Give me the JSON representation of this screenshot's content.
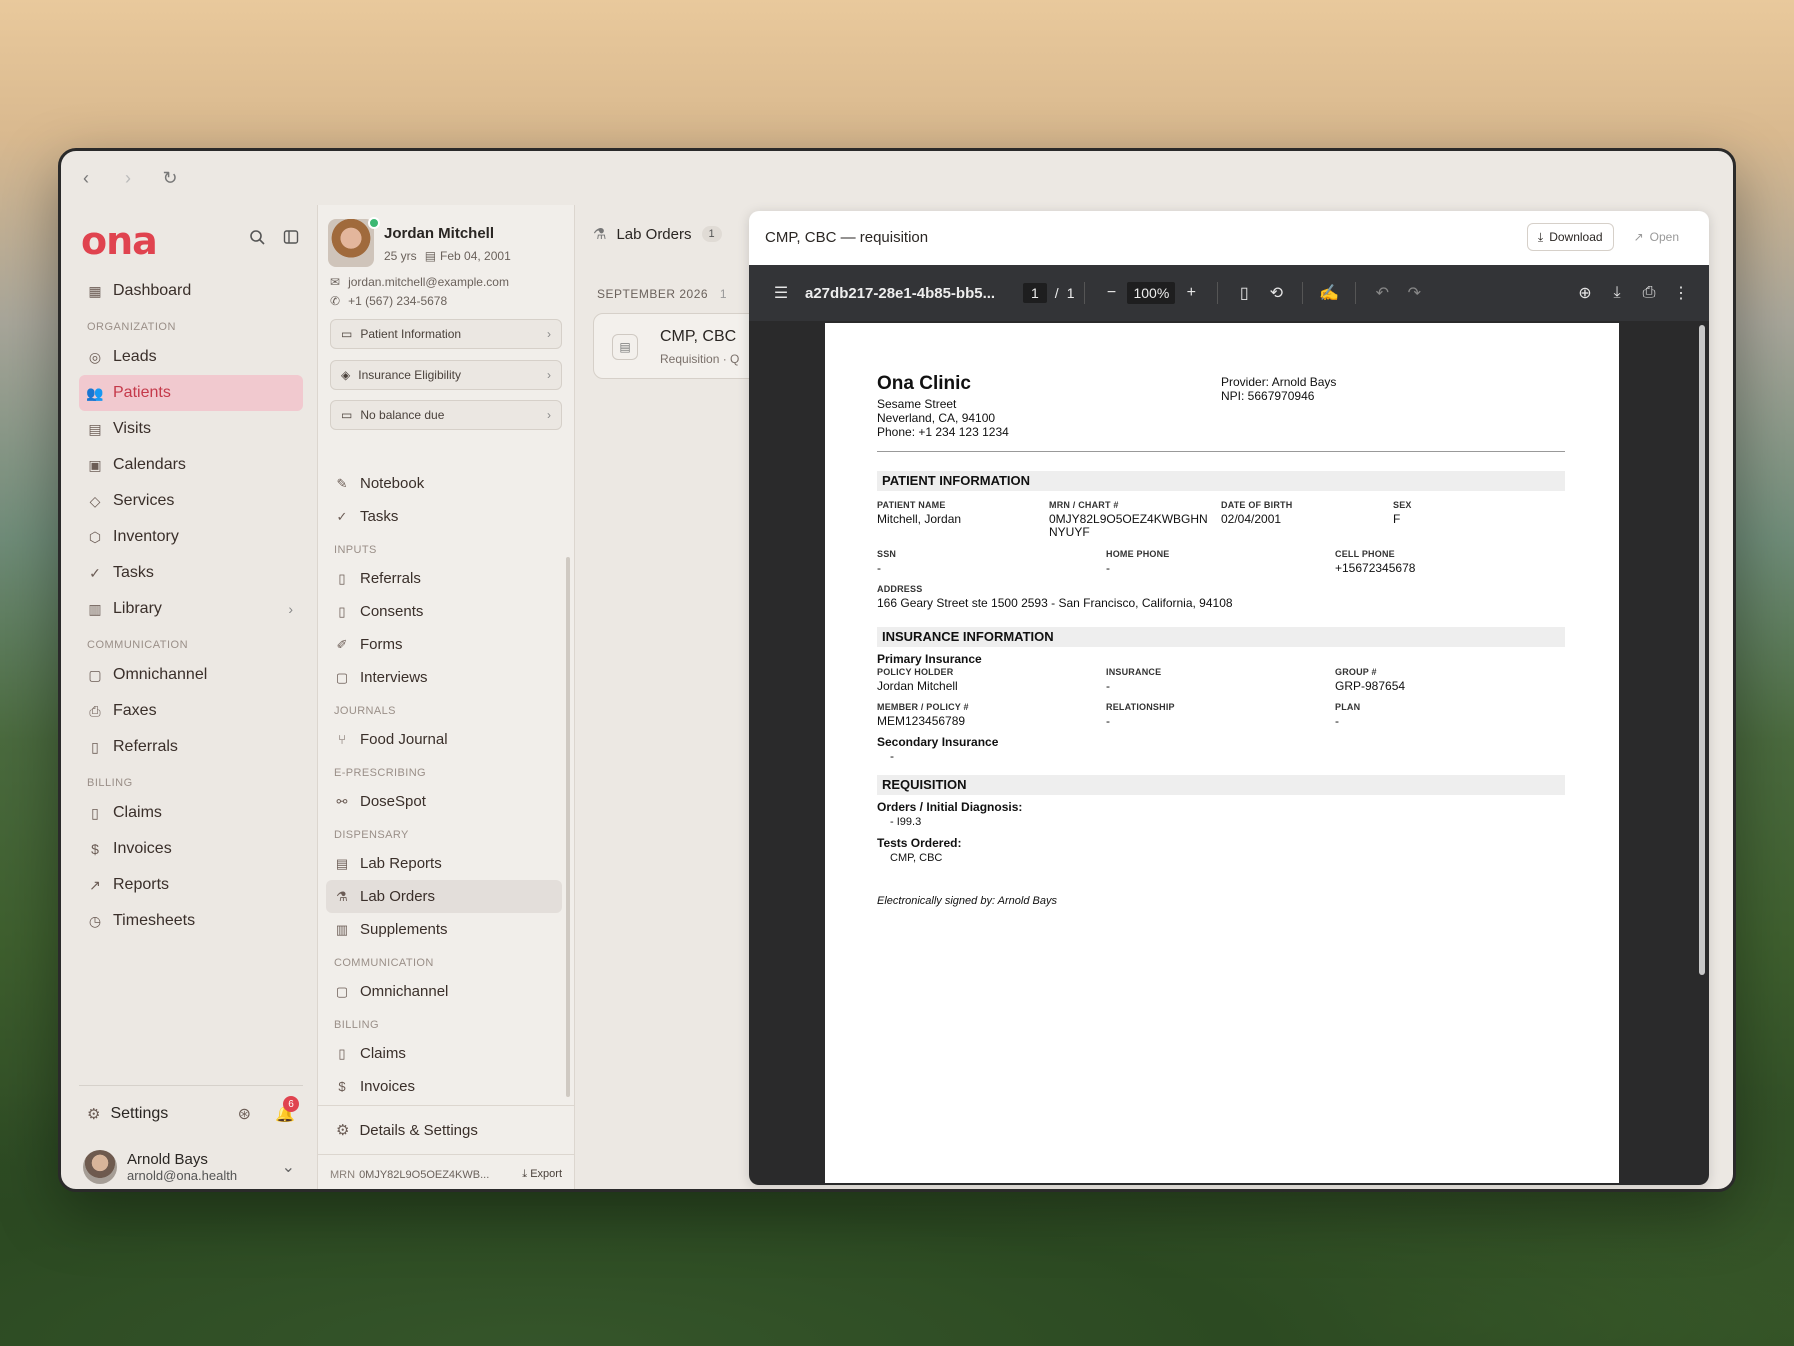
{
  "browser": {
    "back": "‹",
    "forward": "›",
    "reload": "↻"
  },
  "nav": {
    "logo": "ona",
    "items": [
      {
        "label": "Dashboard"
      },
      {
        "section": "ORGANIZATION"
      },
      {
        "label": "Leads"
      },
      {
        "label": "Patients"
      },
      {
        "label": "Visits"
      },
      {
        "label": "Calendars"
      },
      {
        "label": "Services"
      },
      {
        "label": "Inventory"
      },
      {
        "label": "Tasks"
      },
      {
        "label": "Library"
      },
      {
        "section": "COMMUNICATION"
      },
      {
        "label": "Omnichannel"
      },
      {
        "label": "Faxes"
      },
      {
        "label": "Referrals"
      },
      {
        "section": "BILLING"
      },
      {
        "label": "Claims"
      },
      {
        "label": "Invoices"
      },
      {
        "label": "Reports"
      },
      {
        "label": "Timesheets"
      }
    ],
    "settings": "Settings",
    "notifications_count": "6",
    "user": {
      "name": "Arnold Bays",
      "email": "arnold@ona.health"
    }
  },
  "patient": {
    "name": "Jordan Mitchell",
    "age": "25 yrs",
    "dob": "Feb 04, 2001",
    "email": "jordan.mitchell@example.com",
    "phone": "+1 (567) 234-5678",
    "buttons": [
      "Patient Information",
      "Insurance Eligibility",
      "No balance due"
    ],
    "menu": {
      "top": [
        "Notebook",
        "Tasks"
      ],
      "inputs_section": "INPUTS",
      "inputs": [
        "Referrals",
        "Consents",
        "Forms",
        "Interviews"
      ],
      "journals_section": "JOURNALS",
      "journals": [
        "Food Journal"
      ],
      "erx_section": "E-PRESCRIBING",
      "erx": [
        "DoseSpot"
      ],
      "dispensary_section": "DISPENSARY",
      "dispensary": [
        "Lab Reports",
        "Lab Orders",
        "Supplements"
      ],
      "comm_section": "COMMUNICATION",
      "comm": [
        "Omnichannel"
      ],
      "billing_section": "BILLING",
      "billing": [
        "Claims",
        "Invoices"
      ]
    },
    "details": "Details & Settings",
    "mrn_label": "MRN",
    "mrn": "0MJY82L9O5OEZ4KWB...",
    "export": "Export"
  },
  "orders": {
    "title": "Lab Orders",
    "count": "1",
    "month": "SEPTEMBER 2026",
    "month_count": "1",
    "card_title": "CMP, CBC",
    "card_sub": "Requisition · Q"
  },
  "viewer": {
    "title": "CMP, CBC — requisition",
    "download": "Download",
    "open": "Open",
    "file": "a27db217-28e1-4b85-bb5...",
    "page_current": "1",
    "page_total": "1",
    "zoom": "100%"
  },
  "document": {
    "clinic": "Ona Clinic",
    "street": "Sesame Street",
    "city": "Neverland, CA, 94100",
    "clinic_phone": "Phone: +1 234 123 1234",
    "provider": "Provider: Arnold Bays",
    "npi": "NPI: 5667970946",
    "patient_section": "PATIENT INFORMATION",
    "l_name": "PATIENT NAME",
    "v_name": "Mitchell, Jordan",
    "l_mrn": "MRN / CHART #",
    "v_mrn1": "0MJY82L9O5OEZ4KWBGHN",
    "v_mrn2": "NYUYF",
    "l_dob": "DATE OF BIRTH",
    "v_dob": "02/04/2001",
    "l_sex": "SEX",
    "v_sex": "F",
    "l_ssn": "SSN",
    "v_ssn": "-",
    "l_home": "HOME PHONE",
    "v_home": "-",
    "l_cell": "CELL PHONE",
    "v_cell": "+15672345678",
    "l_addr": "ADDRESS",
    "v_addr": "166 Geary Street ste 1500 2593 - San Francisco, California, 94108",
    "insurance_section": "INSURANCE INFORMATION",
    "primary": "Primary Insurance",
    "l_holder": "POLICY HOLDER",
    "v_holder": "Jordan Mitchell",
    "l_ins": "INSURANCE",
    "v_ins": "-",
    "l_group": "GROUP #",
    "v_group": "GRP-987654",
    "l_member": "MEMBER / POLICY #",
    "v_member": "MEM123456789",
    "l_rel": "RELATIONSHIP",
    "v_rel": "-",
    "l_plan": "PLAN",
    "v_plan": "-",
    "secondary": "Secondary Insurance",
    "v_secondary": "-",
    "req_section": "REQUISITION",
    "orders_label": "Orders / Initial Diagnosis:",
    "diagnosis": "-  I99.3",
    "tests_label": "Tests Ordered:",
    "tests": "CMP, CBC",
    "signature": "Electronically signed by: Arnold Bays"
  }
}
